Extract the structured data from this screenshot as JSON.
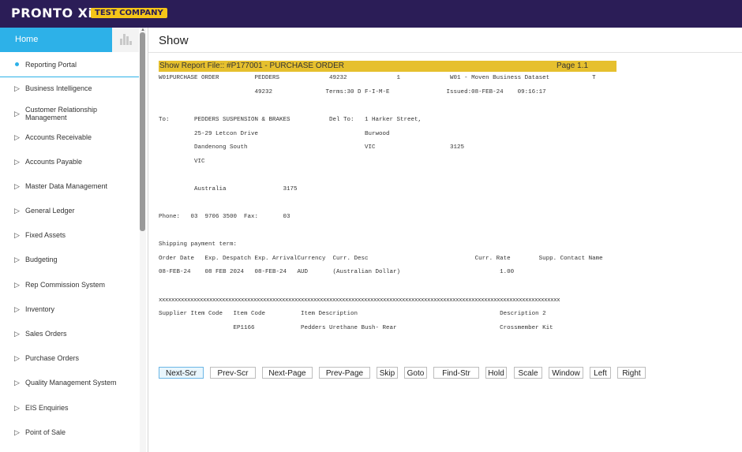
{
  "topbar": {
    "logo": "PRONTO Xi",
    "company": "TEST COMPANY"
  },
  "sidebar": {
    "home": "Home",
    "items": [
      {
        "label": "Reporting Portal"
      },
      {
        "label": "Business Intelligence"
      },
      {
        "label": "Customer Relationship Management"
      },
      {
        "label": "Accounts Receivable"
      },
      {
        "label": "Accounts Payable"
      },
      {
        "label": "Master Data Management"
      },
      {
        "label": "General Ledger"
      },
      {
        "label": "Fixed Assets"
      },
      {
        "label": "Budgeting"
      },
      {
        "label": "Rep Commission System"
      },
      {
        "label": "Inventory"
      },
      {
        "label": "Sales Orders"
      },
      {
        "label": "Purchase Orders"
      },
      {
        "label": "Quality Management System"
      },
      {
        "label": "EIS Enquiries"
      },
      {
        "label": "Point of Sale"
      }
    ]
  },
  "main": {
    "title": "Show",
    "report_header": "Show Report File:: #P177001  -  PURCHASE ORDER",
    "page": "Page 1.1",
    "lines": [
      "W01PURCHASE ORDER          PEDDERS              49232              1              W01 - Moven Business Dataset            T",
      "                           49232               Terms:30 D F-I-M-E                Issued:08-FEB-24    09:16:17",
      "",
      "To:       PEDDERS SUSPENSION & BRAKES           Del To:   1 Harker Street,",
      "          25-29 Letcon Drive                              Burwood",
      "          Dandenong South                                 VIC                     3125",
      "          VIC",
      "",
      "          Australia                3175",
      "",
      "Phone:   03  9706 3500  Fax:       03",
      "",
      "Shipping payment term:",
      "Order Date   Exp. Despatch Exp. ArrivalCurrency  Curr. Desc                              Curr. Rate        Supp. Contact Name",
      "08-FEB-24    08 FEB 2024   08-FEB-24   AUD       (Australian Dollar)                            1.00",
      "",
      "xxxxxxxxxxxxxxxxxxxxxxxxxxxxxxxxxxxxxxxxxxxxxxxxxxxxxxxxxxxxxxxxxxxxxxxxxxxxxxxxxxxxxxxxxxxxxxxxxxxxxxxxxxxxxxxxxxxxxxxxxxxxxxx",
      "Supplier Item Code   Item Code          Item Description                                        Description 2",
      "                     EP1166             Pedders Urethane Bush- Rear                             Crossmember Kit"
    ],
    "buttons": [
      "Next-Scr",
      "Prev-Scr",
      "Next-Page",
      "Prev-Page",
      "Skip",
      "Goto",
      "Find-Str",
      "Hold",
      "Scale",
      "Window",
      "Left",
      "Right"
    ]
  }
}
